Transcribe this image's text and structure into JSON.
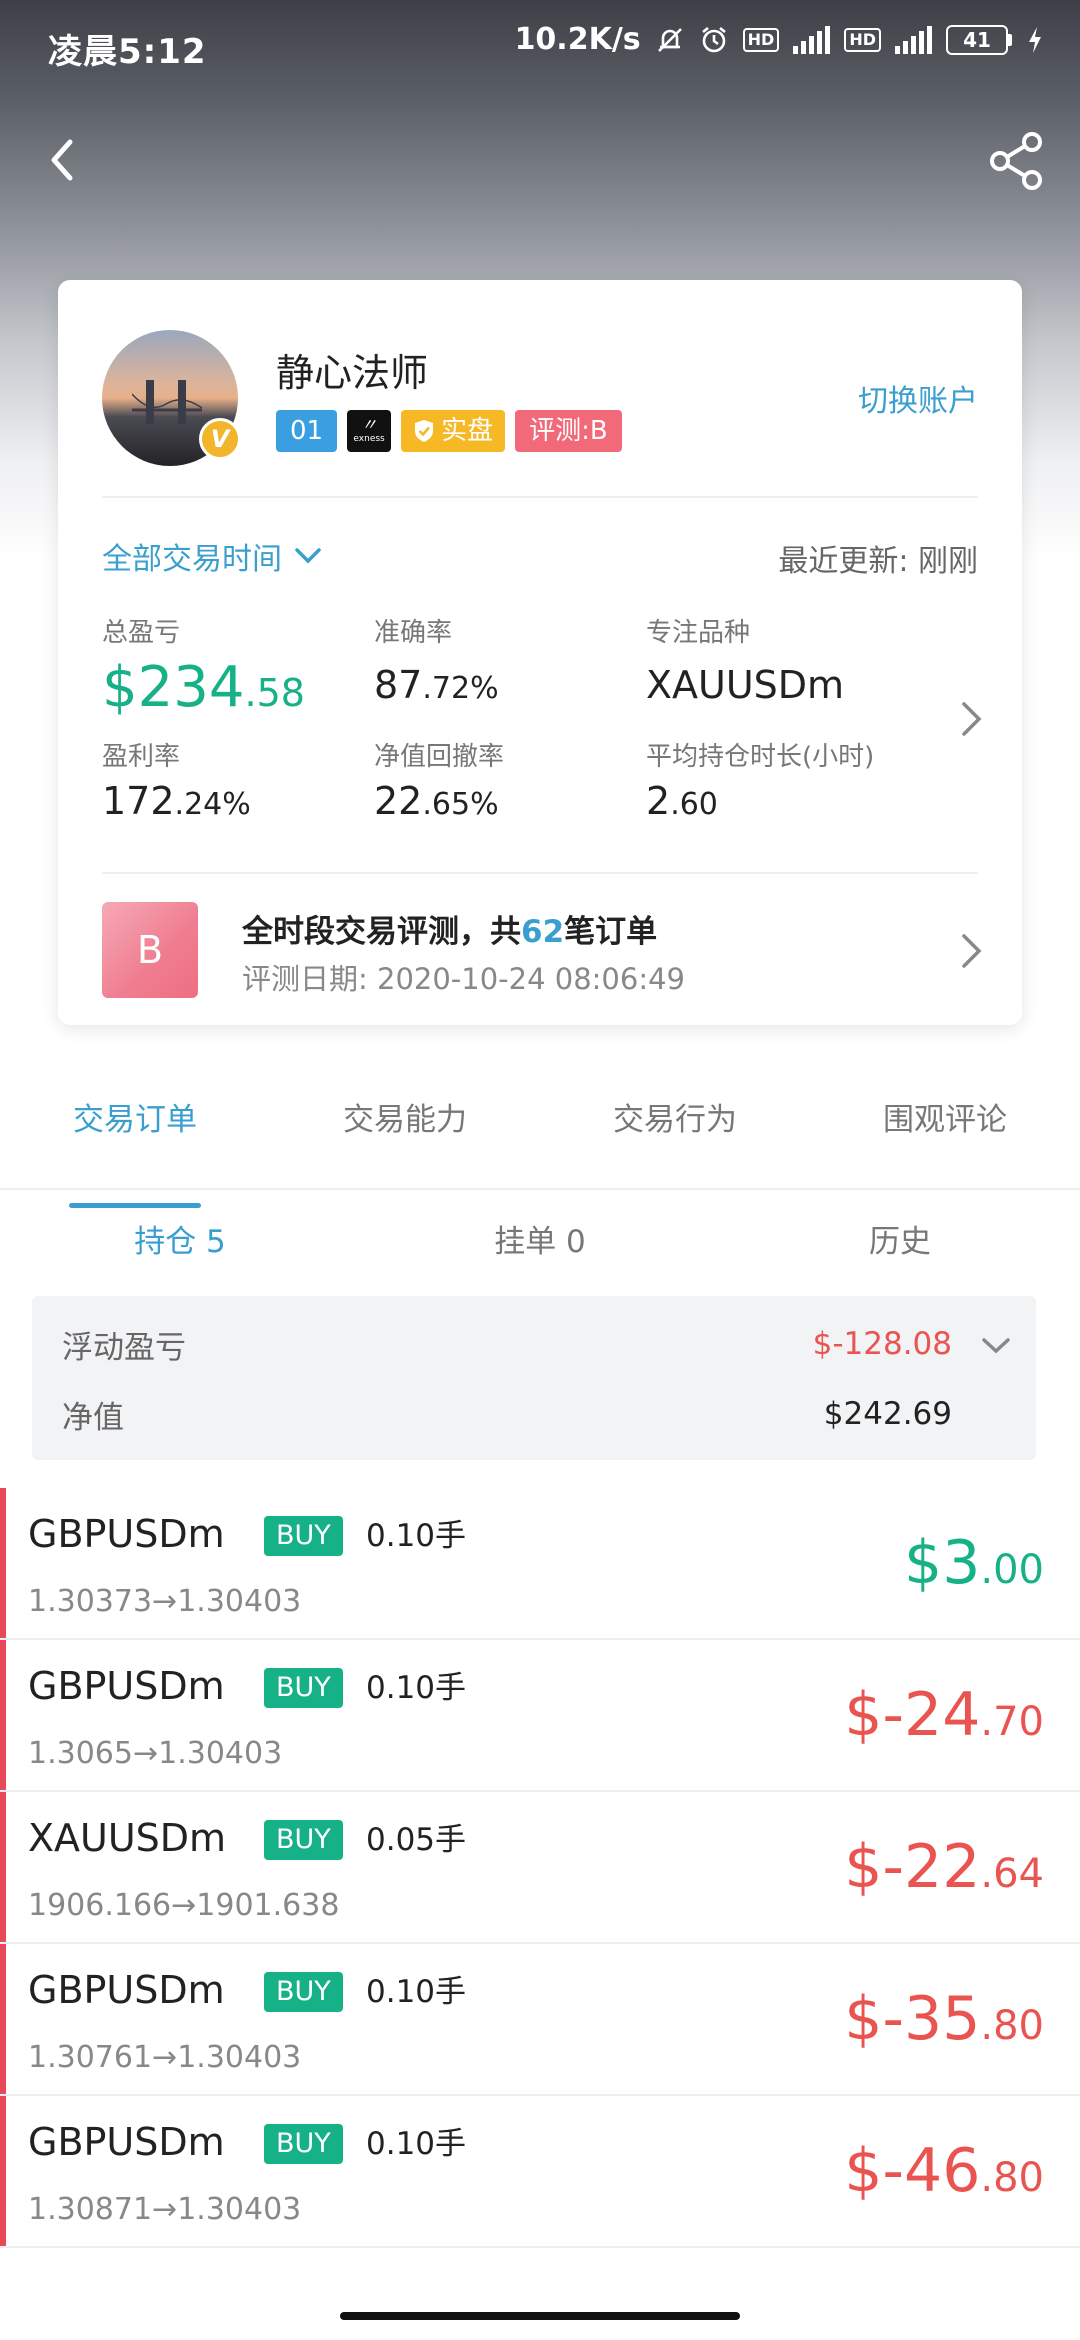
{
  "status_bar": {
    "time": "凌晨5:12",
    "net_speed": "10.2K/s",
    "battery": "41",
    "hd": "HD",
    "net_type": "4G"
  },
  "profile": {
    "username": "静心法师",
    "account_number": "01",
    "broker_tag": "exness",
    "real_tag": "实盘",
    "rating_tag": "评测:B",
    "switch_account": "切换账户",
    "verified_badge": "V"
  },
  "filters": {
    "period": "全部交易时间",
    "updated": "最近更新: 刚刚"
  },
  "stats": {
    "total_pnl_label": "总盈亏",
    "total_pnl_int": "$234",
    "total_pnl_dec": ".58",
    "accuracy_label": "准确率",
    "accuracy_int": "87",
    "accuracy_dec": ".72%",
    "focus_label": "专注品种",
    "focus_value": "XAUUSDm",
    "profit_rate_label": "盈利率",
    "profit_rate_int": "172",
    "profit_rate_dec": ".24%",
    "drawdown_label": "净值回撤率",
    "drawdown_int": "22",
    "drawdown_dec": ".65%",
    "hold_label": "平均持仓时长(小时)",
    "hold_int": "2",
    "hold_dec": ".60"
  },
  "evaluation": {
    "grade": "B",
    "title_prefix": "全时段交易评测，共",
    "order_count": "62",
    "title_suffix": "笔订单",
    "date": "评测日期: 2020-10-24 08:06:49"
  },
  "tabs": [
    "交易订单",
    "交易能力",
    "交易行为",
    "围观评论"
  ],
  "subtabs": [
    "持仓 5",
    "挂单 0",
    "历史"
  ],
  "summary": {
    "float_label": "浮动盈亏",
    "float_value": "$-128.08",
    "equity_label": "净值",
    "equity_value": "$242.69"
  },
  "orders": [
    {
      "symbol": "GBPUSDm",
      "side": "BUY",
      "lots": "0.10手",
      "prices": "1.30373→1.30403",
      "pnl_int": "$3",
      "pnl_dec": ".00"
    },
    {
      "symbol": "GBPUSDm",
      "side": "BUY",
      "lots": "0.10手",
      "prices": "1.3065→1.30403",
      "pnl_int": "$-24",
      "pnl_dec": ".70"
    },
    {
      "symbol": "XAUUSDm",
      "side": "BUY",
      "lots": "0.05手",
      "prices": "1906.166→1901.638",
      "pnl_int": "$-22",
      "pnl_dec": ".64"
    },
    {
      "symbol": "GBPUSDm",
      "side": "BUY",
      "lots": "0.10手",
      "prices": "1.30761→1.30403",
      "pnl_int": "$-35",
      "pnl_dec": ".80"
    },
    {
      "symbol": "GBPUSDm",
      "side": "BUY",
      "lots": "0.10手",
      "prices": "1.30871→1.30403",
      "pnl_int": "$-46",
      "pnl_dec": ".80"
    }
  ],
  "colors": {
    "accent": "#3a9fcf",
    "profit": "#17b188",
    "loss": "#e95451",
    "rating": "#f26a7a",
    "real": "#f6b824"
  }
}
